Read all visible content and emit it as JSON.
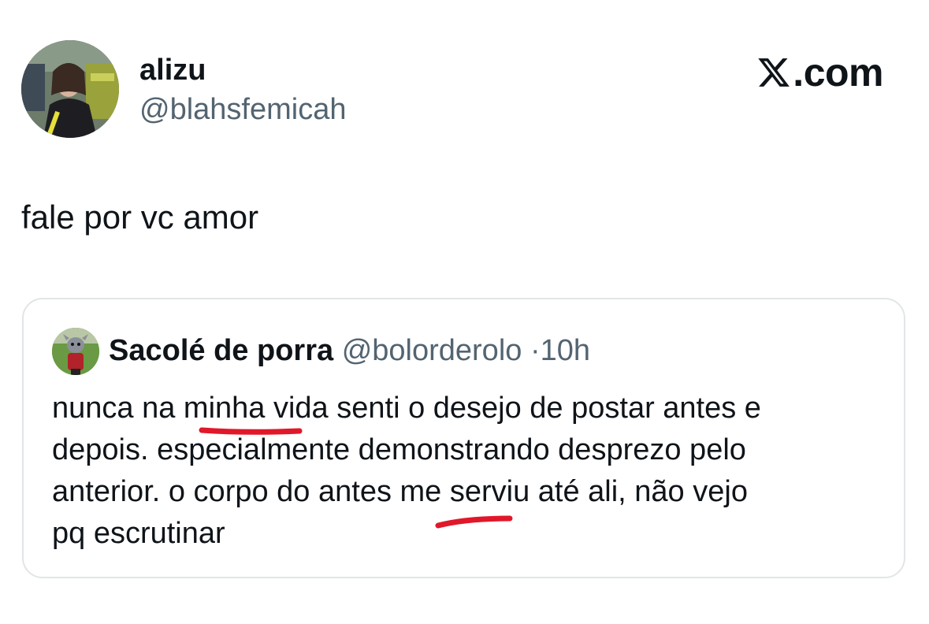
{
  "author": {
    "display_name": "alizu",
    "handle": "@blahsfemicah"
  },
  "brand": {
    "label": ".com",
    "icon": "x-logo-icon"
  },
  "tweet": {
    "text": "fale por vc amor"
  },
  "quoted_tweet": {
    "display_name": "Sacolé de porra",
    "handle": "@bolorderolo",
    "separator": "·",
    "time": "10h",
    "lines": [
      "nunca na minha vida senti o desejo de postar antes e",
      "depois. especialmente demonstrando desprezo pelo",
      "anterior. o corpo do antes me serviu até ali, não vejo",
      "pq escrutinar"
    ]
  },
  "annotations": {
    "underline_color": "#e0182a"
  }
}
